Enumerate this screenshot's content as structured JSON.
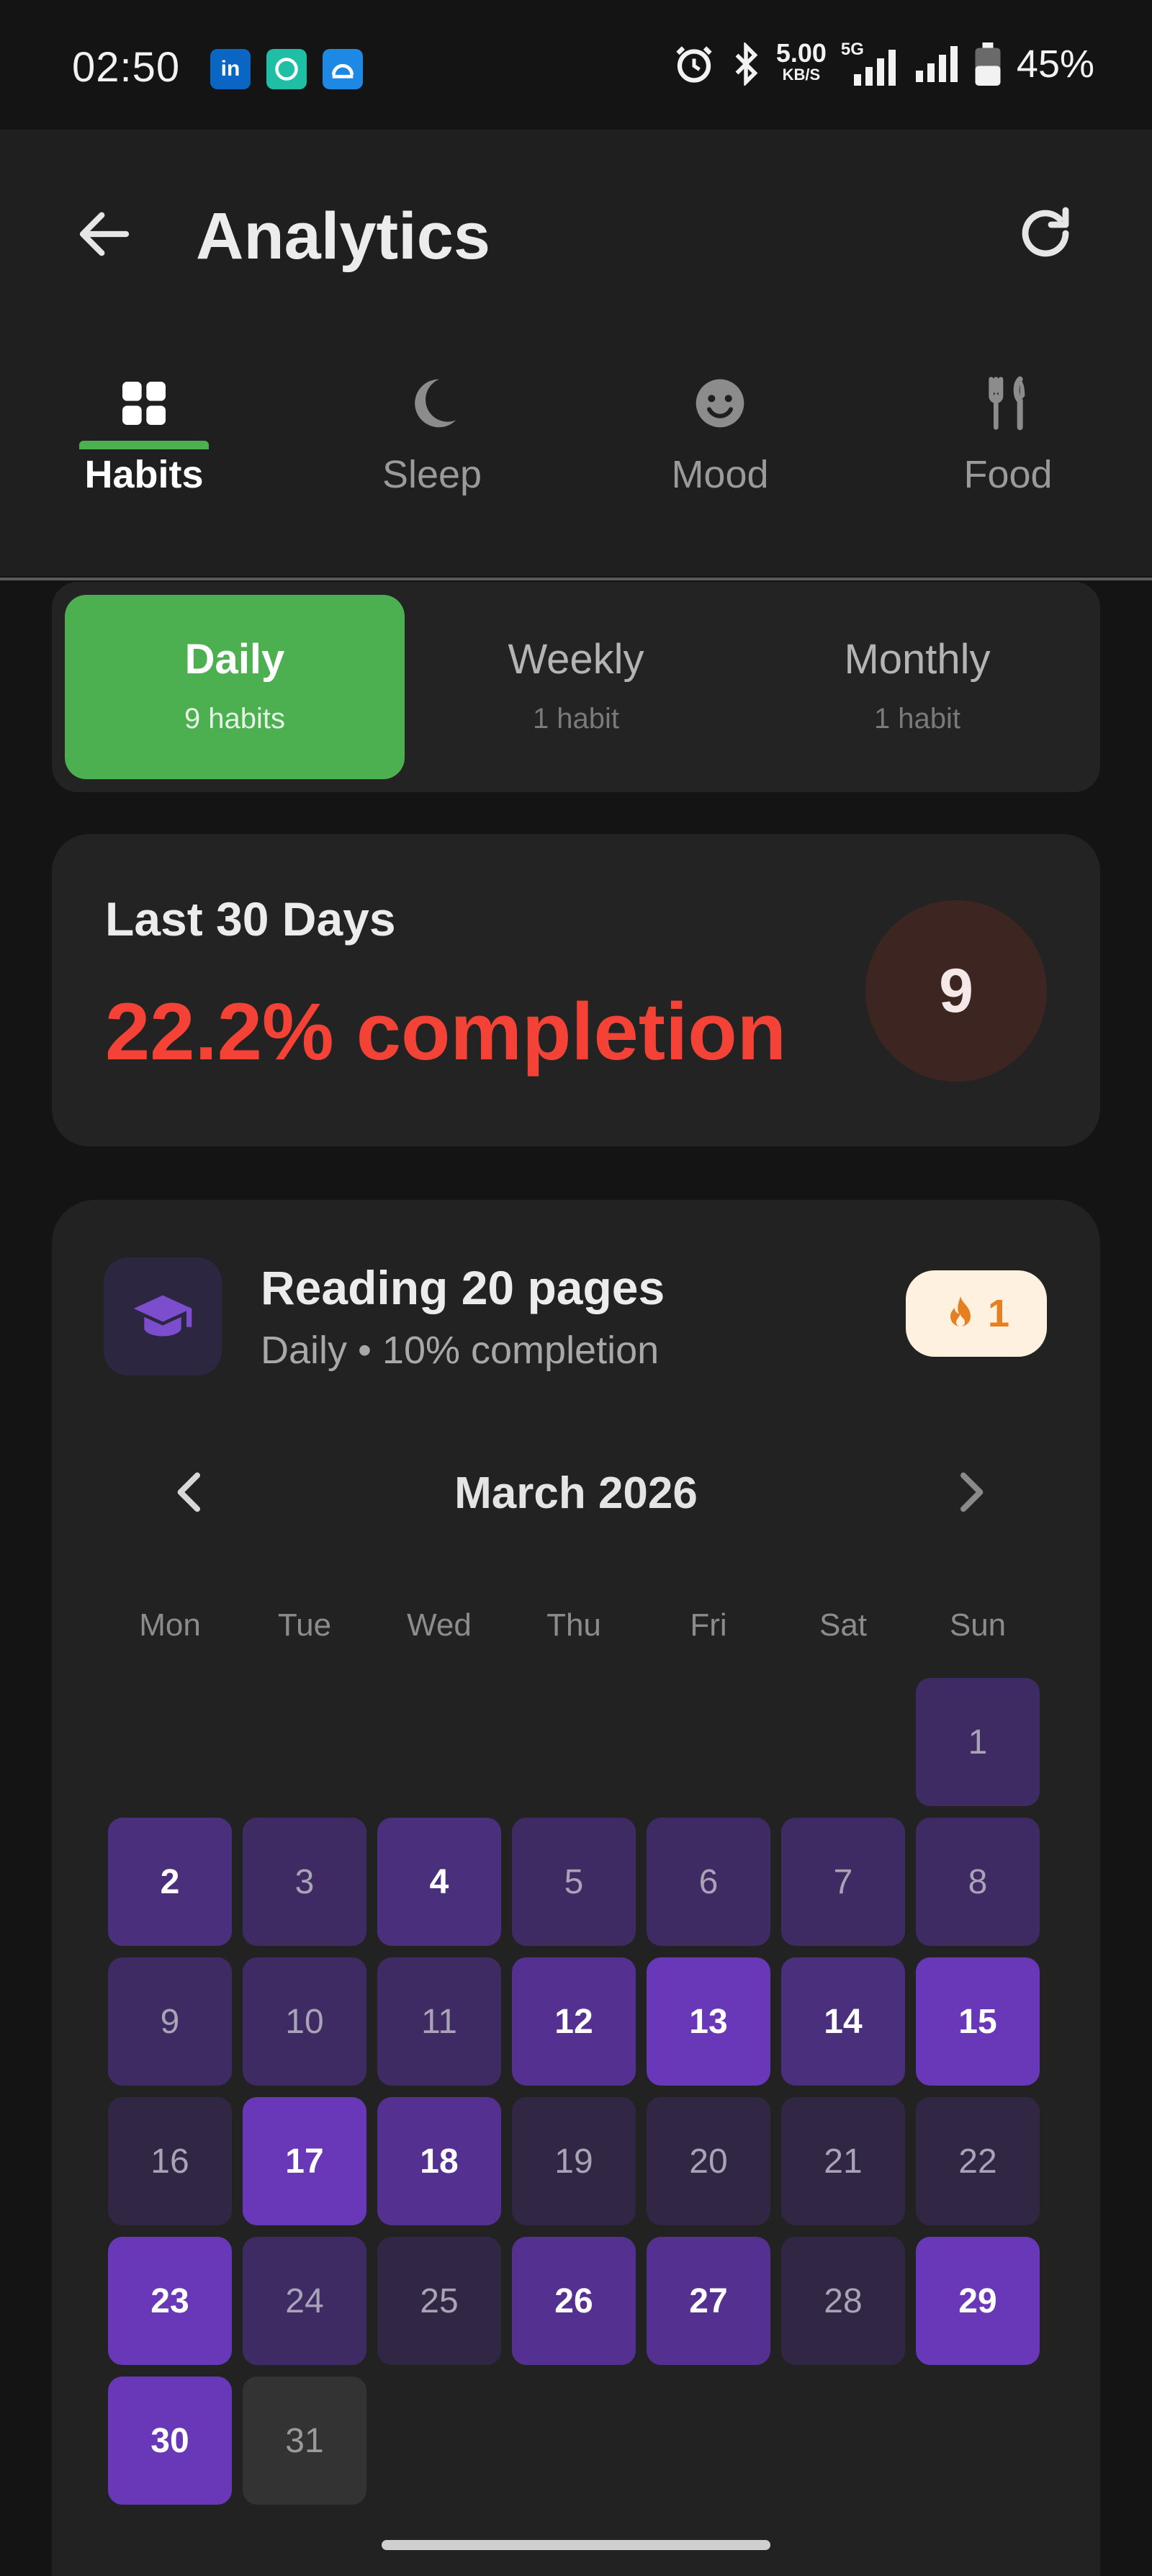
{
  "status_bar": {
    "time": "02:50",
    "apps": [
      {
        "name": "linkedin-icon",
        "glyph": "in",
        "color": "#0a66c2"
      },
      {
        "name": "chat-app-icon",
        "glyph": "●",
        "color": "#1fbfa6"
      },
      {
        "name": "cloud-app-icon",
        "glyph": "☁",
        "color": "#1e88e5"
      }
    ],
    "speed_value": "5.00",
    "speed_unit": "KB/S",
    "network_label": "5G",
    "battery": "45%"
  },
  "header": {
    "title": "Analytics"
  },
  "tabs": [
    {
      "label": "Habits",
      "icon": "grid-icon",
      "active": true
    },
    {
      "label": "Sleep",
      "icon": "moon-icon",
      "active": false
    },
    {
      "label": "Mood",
      "icon": "smile-icon",
      "active": false
    },
    {
      "label": "Food",
      "icon": "cutlery-icon",
      "active": false
    }
  ],
  "frequency_selector": [
    {
      "label": "Daily",
      "count": "9 habits",
      "active": true
    },
    {
      "label": "Weekly",
      "count": "1 habit",
      "active": false
    },
    {
      "label": "Monthly",
      "count": "1 habit",
      "active": false
    }
  ],
  "summary": {
    "title": "Last 30 Days",
    "completion": "22.2% completion",
    "habit_count": "9"
  },
  "habit": {
    "name": "Reading 20 pages",
    "subtitle": "Daily • 10% completion",
    "icon": "graduation-cap-icon",
    "streak": "1",
    "month": "March 2026",
    "weekdays": [
      "Mon",
      "Tue",
      "Wed",
      "Thu",
      "Fri",
      "Sat",
      "Sun"
    ],
    "first_weekday_index": 6,
    "days": [
      {
        "d": "1",
        "level": 1
      },
      {
        "d": "2",
        "level": 2
      },
      {
        "d": "3",
        "level": 1
      },
      {
        "d": "4",
        "level": 2
      },
      {
        "d": "5",
        "level": 1
      },
      {
        "d": "6",
        "level": 1
      },
      {
        "d": "7",
        "level": 1
      },
      {
        "d": "8",
        "level": 1
      },
      {
        "d": "9",
        "level": 1
      },
      {
        "d": "10",
        "level": 1
      },
      {
        "d": "11",
        "level": 1
      },
      {
        "d": "12",
        "level": 3
      },
      {
        "d": "13",
        "level": 4
      },
      {
        "d": "14",
        "level": 2
      },
      {
        "d": "15",
        "level": 4
      },
      {
        "d": "16",
        "level": 0
      },
      {
        "d": "17",
        "level": 4
      },
      {
        "d": "18",
        "level": 3
      },
      {
        "d": "19",
        "level": 0
      },
      {
        "d": "20",
        "level": 0
      },
      {
        "d": "21",
        "level": 0
      },
      {
        "d": "22",
        "level": 0
      },
      {
        "d": "23",
        "level": 4
      },
      {
        "d": "24",
        "level": 1
      },
      {
        "d": "25",
        "level": 0
      },
      {
        "d": "26",
        "level": 3
      },
      {
        "d": "27",
        "level": 3
      },
      {
        "d": "28",
        "level": 0
      },
      {
        "d": "29",
        "level": 4
      },
      {
        "d": "30",
        "level": 4
      },
      {
        "d": "31",
        "level": -1
      }
    ],
    "level_colors": {
      "-1": "#333333",
      "0": "#312744",
      "1": "#3e2b64",
      "2": "#4a2f7c",
      "3": "#543190",
      "4": "#6838b8"
    }
  },
  "colors": {
    "accent_green": "#4caf50",
    "completion_red": "#f44336",
    "streak_orange": "#e67e22"
  }
}
